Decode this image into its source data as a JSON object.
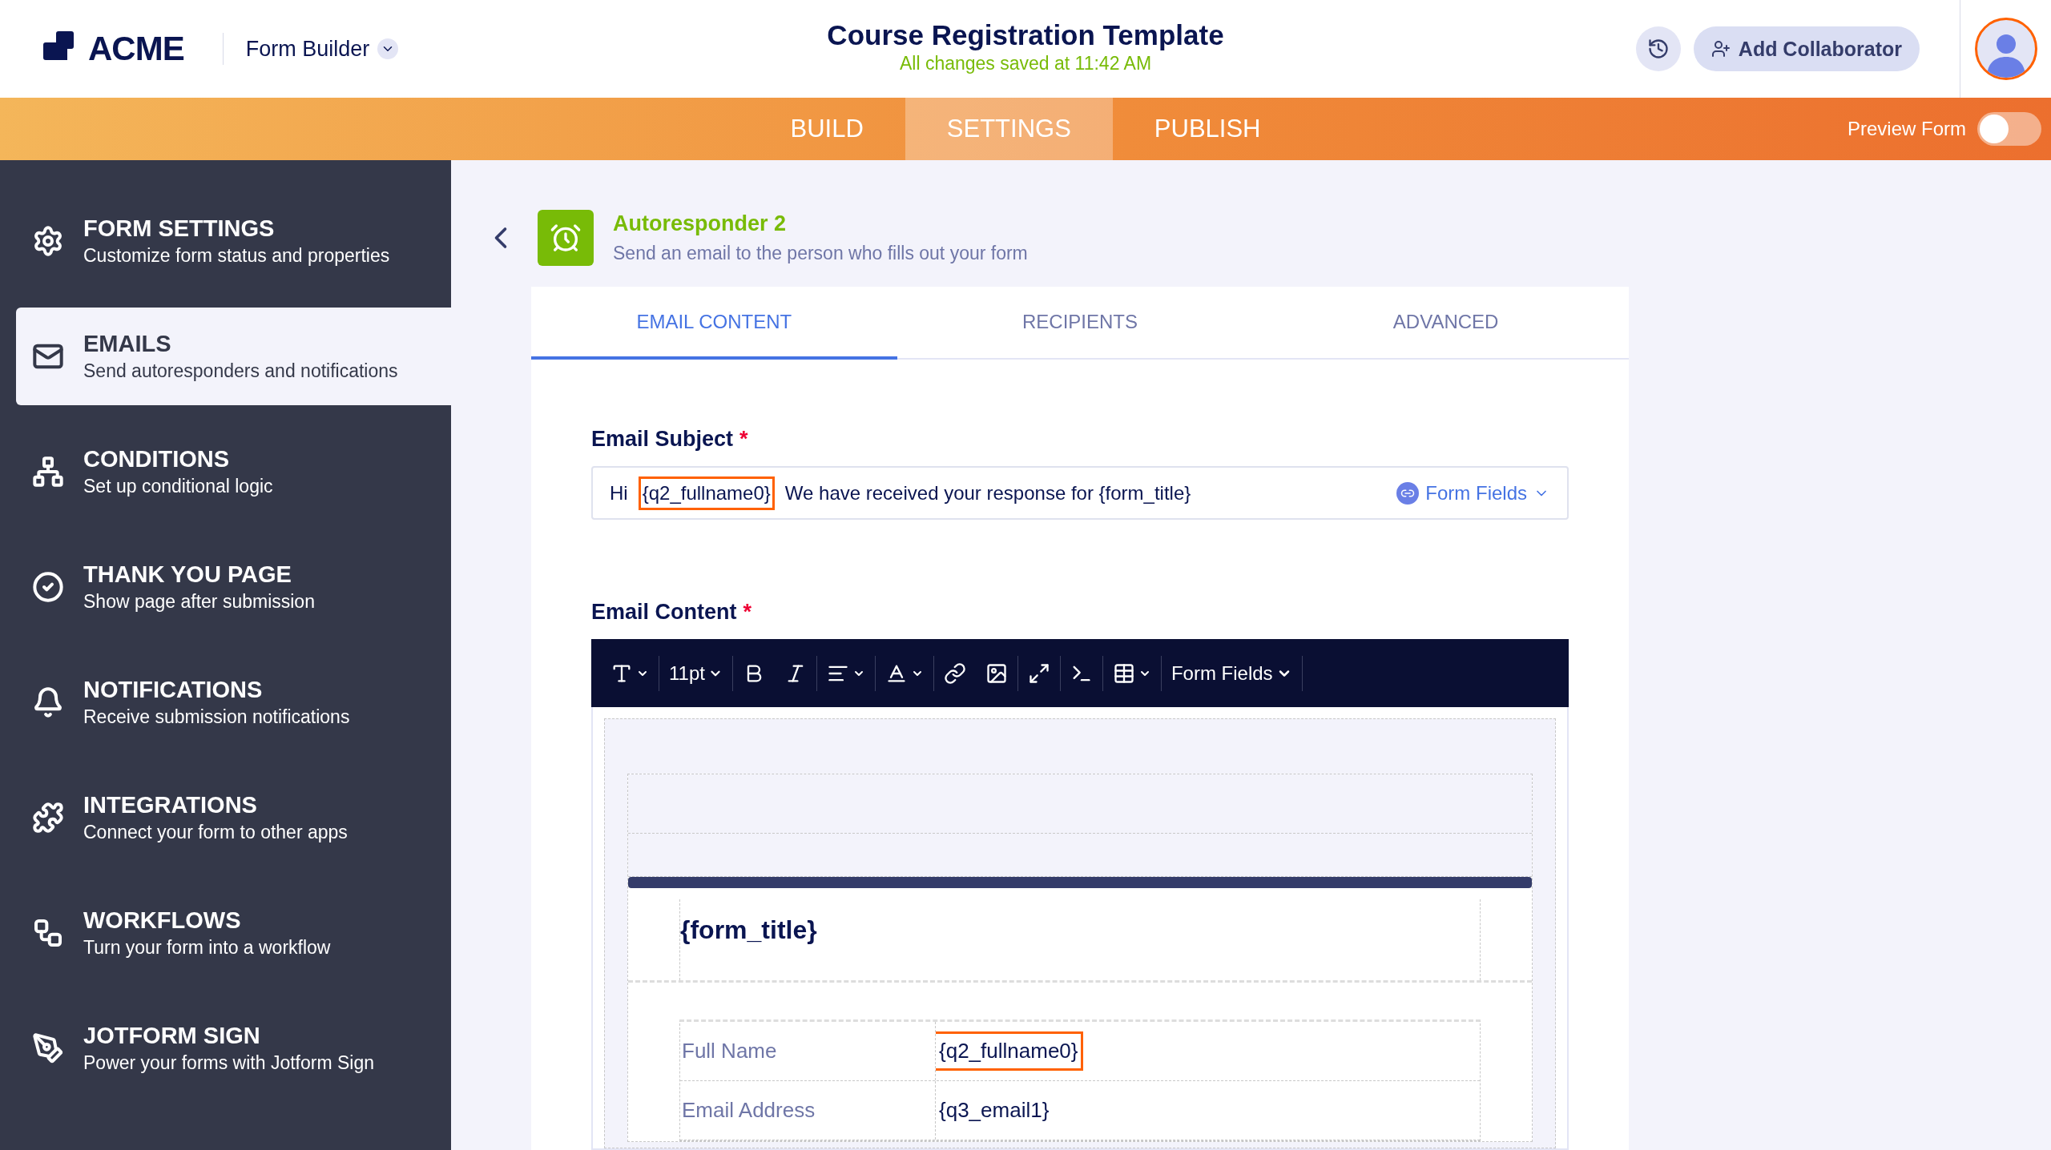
{
  "header": {
    "logo": "ACME",
    "app_menu": "Form Builder",
    "title": "Course Registration Template",
    "save_status": "All changes saved at 11:42 AM",
    "collaborator_button": "Add Collaborator"
  },
  "nav_tabs": [
    {
      "label": "BUILD",
      "selected": false
    },
    {
      "label": "SETTINGS",
      "selected": true
    },
    {
      "label": "PUBLISH",
      "selected": false
    }
  ],
  "preview_toggle": {
    "label": "Preview Form",
    "on": false
  },
  "sidebar": {
    "items": [
      {
        "kind": "gear",
        "title": "FORM SETTINGS",
        "description": "Customize form status and properties",
        "selected": false
      },
      {
        "kind": "mail",
        "title": "EMAILS",
        "description": "Send autoresponders and notifications",
        "selected": true
      },
      {
        "kind": "tree",
        "title": "CONDITIONS",
        "description": "Set up conditional logic",
        "selected": false
      },
      {
        "kind": "check",
        "title": "THANK YOU PAGE",
        "description": "Show page after submission",
        "selected": false
      },
      {
        "kind": "bell",
        "title": "NOTIFICATIONS",
        "description": "Receive submission notifications",
        "selected": false
      },
      {
        "kind": "puzzle",
        "title": "INTEGRATIONS",
        "description": "Connect your form to other apps",
        "selected": false
      },
      {
        "kind": "flow",
        "title": "WORKFLOWS",
        "description": "Turn your form into a workflow",
        "selected": false
      },
      {
        "kind": "pen",
        "title": "JOTFORM SIGN",
        "description": "Power your forms with Jotform Sign",
        "selected": false
      }
    ]
  },
  "email": {
    "title": "Autoresponder 2",
    "description": "Send an email to the person who fills out your form"
  },
  "tabs": [
    {
      "label": "EMAIL CONTENT",
      "selected": true
    },
    {
      "label": "RECIPIENTS",
      "selected": false
    },
    {
      "label": "ADVANCED",
      "selected": false
    }
  ],
  "subject": {
    "label": "Email Subject",
    "required_mark": "*",
    "segments": [
      {
        "text": "Hi",
        "highlighted": false
      },
      {
        "text": "{q2_fullname0}",
        "highlighted": true
      },
      {
        "text": "We have received your response for {form_title}",
        "highlighted": false
      }
    ],
    "form_fields_button": "Form Fields"
  },
  "content": {
    "label": "Email Content",
    "required_mark": "*",
    "toolbar": [
      {
        "kind": "text-style"
      },
      {
        "kind": "font-size",
        "text": "11pt"
      },
      {
        "kind": "bold"
      },
      {
        "kind": "italic"
      },
      {
        "kind": "align"
      },
      {
        "kind": "text-color"
      },
      {
        "kind": "link"
      },
      {
        "kind": "image"
      },
      {
        "kind": "expand"
      },
      {
        "kind": "terminal"
      },
      {
        "kind": "table"
      },
      {
        "kind": "form-fields",
        "text": "Form Fields"
      }
    ],
    "form_title": "{form_title}",
    "rows": [
      {
        "label": "Full Name",
        "value": "{q2_fullname0}",
        "highlighted": true
      },
      {
        "label": "Email Address",
        "value": "{q3_email1}",
        "highlighted": false
      }
    ]
  }
}
